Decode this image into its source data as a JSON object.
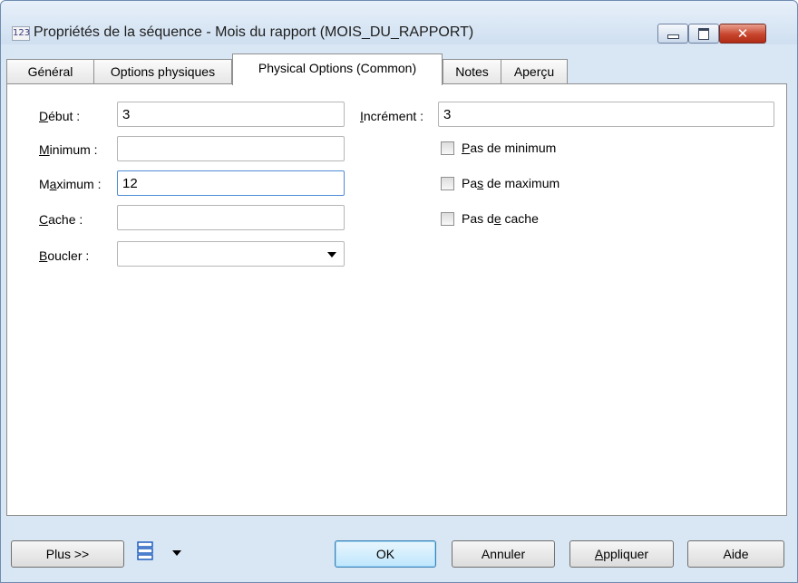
{
  "window": {
    "title": "Propriétés de la séquence - Mois du rapport (MOIS_DU_RAPPORT)",
    "icon_text": "123",
    "controls": {
      "minimize": "minimize-icon",
      "maximize": "maximize-icon",
      "close": "✕"
    }
  },
  "tabs": [
    {
      "label": "Général",
      "active": false
    },
    {
      "label": "Options physiques",
      "active": false
    },
    {
      "label": "Physical Options (Common)",
      "active": true
    },
    {
      "label": "Notes",
      "active": false
    },
    {
      "label": "Aperçu",
      "active": false
    }
  ],
  "form": {
    "debut": {
      "label_pre": "",
      "label_u": "D",
      "label_post": "ébut :",
      "value": "3"
    },
    "minimum": {
      "label_pre": "",
      "label_u": "M",
      "label_post": "inimum :",
      "value": ""
    },
    "maximum": {
      "label_pre": "M",
      "label_u": "a",
      "label_post": "ximum :",
      "value": "12"
    },
    "cache": {
      "label_pre": "",
      "label_u": "C",
      "label_post": "ache :",
      "value": ""
    },
    "boucler": {
      "label_pre": "",
      "label_u": "B",
      "label_post": "oucler :",
      "value": ""
    },
    "increment": {
      "label_pre": "",
      "label_u": "I",
      "label_post": "ncrément :",
      "value": "3"
    },
    "pas_minimum": {
      "label_pre": "",
      "label_u": "P",
      "label_post": "as de minimum",
      "checked": false
    },
    "pas_maximum": {
      "label_pre": "Pa",
      "label_u": "s",
      "label_post": " de maximum",
      "checked": false
    },
    "pas_cache": {
      "label_pre": "Pas d",
      "label_u": "e",
      "label_post": " cache",
      "checked": false
    }
  },
  "footer": {
    "plus": "Plus >>",
    "ok": "OK",
    "annuler": "Annuler",
    "appliquer_u": "A",
    "appliquer_rest": "ppliquer",
    "aide": "Aide",
    "layout_icon": "list-layout-icon"
  }
}
